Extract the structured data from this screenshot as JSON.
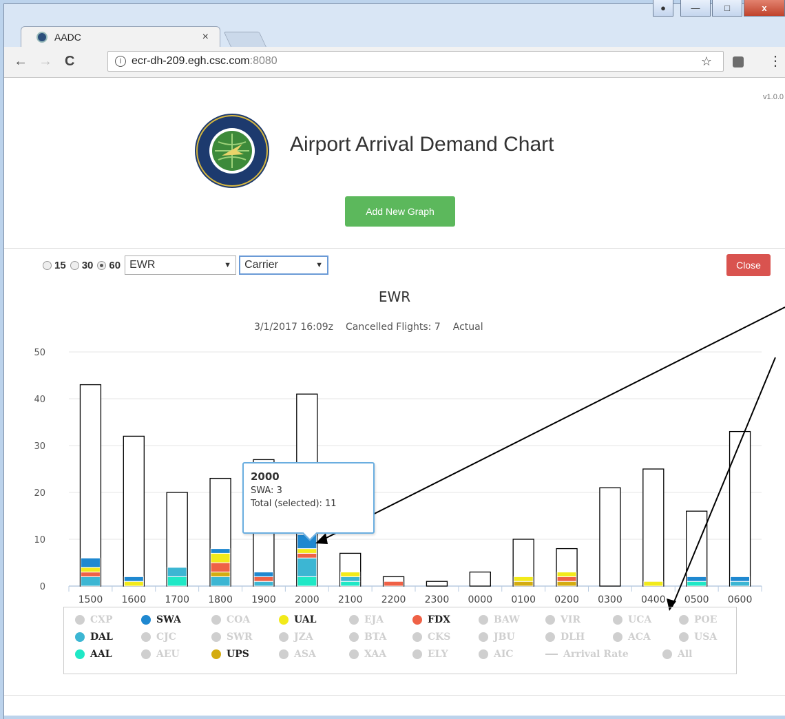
{
  "window": {
    "controls": [
      "user",
      "minimize",
      "maximize",
      "close"
    ],
    "close_glyph": "x"
  },
  "browser": {
    "tab_title": "AADC",
    "tab_close": "×",
    "url_host": "ecr-dh-209.egh.csc.com",
    "url_port": ":8080",
    "info_glyph": "i",
    "star_glyph": "☆",
    "menu_glyph": "⋮",
    "back_glyph": "←",
    "forward_glyph": "→",
    "reload_glyph": "C"
  },
  "page": {
    "version": "v1.0.0",
    "title": "Airport Arrival Demand Chart",
    "add_button": "Add New Graph"
  },
  "controls": {
    "intervals": [
      {
        "label": "15",
        "selected": false
      },
      {
        "label": "30",
        "selected": false
      },
      {
        "label": "60",
        "selected": true
      }
    ],
    "airport_select": "EWR",
    "group_select": "Carrier",
    "close_button": "Close"
  },
  "tooltip": {
    "title": "2000",
    "line1": "SWA: 3",
    "line2": "Total (selected): 11"
  },
  "legend": [
    [
      "CXP",
      "off",
      "#cfcfcf"
    ],
    [
      "SWA",
      "on",
      "#1f88d0"
    ],
    [
      "COA",
      "off",
      "#cfcfcf"
    ],
    [
      "UAL",
      "on",
      "#f2ea1a"
    ],
    [
      "EJA",
      "off",
      "#cfcfcf"
    ],
    [
      "FDX",
      "on",
      "#ef6146"
    ],
    [
      "BAW",
      "off",
      "#cfcfcf"
    ],
    [
      "VIR",
      "off",
      "#cfcfcf"
    ],
    [
      "UCA",
      "off",
      "#cfcfcf"
    ],
    [
      "POE",
      "off",
      "#cfcfcf"
    ],
    [
      "DAL",
      "on",
      "#3cb6d3"
    ],
    [
      "CJC",
      "off",
      "#cfcfcf"
    ],
    [
      "SWR",
      "off",
      "#cfcfcf"
    ],
    [
      "JZA",
      "off",
      "#cfcfcf"
    ],
    [
      "BTA",
      "off",
      "#cfcfcf"
    ],
    [
      "CKS",
      "off",
      "#cfcfcf"
    ],
    [
      "JBU",
      "off",
      "#cfcfcf"
    ],
    [
      "DLH",
      "off",
      "#cfcfcf"
    ],
    [
      "ACA",
      "off",
      "#cfcfcf"
    ],
    [
      "USA",
      "off",
      "#cfcfcf"
    ],
    [
      "AAL",
      "on",
      "#1fe8c6"
    ],
    [
      "AEU",
      "off",
      "#cfcfcf"
    ],
    [
      "UPS",
      "on",
      "#d4ac10"
    ],
    [
      "ASA",
      "off",
      "#cfcfcf"
    ],
    [
      "XAA",
      "off",
      "#cfcfcf"
    ],
    [
      "ELY",
      "off",
      "#cfcfcf"
    ],
    [
      "AIC",
      "off",
      "#cfcfcf"
    ],
    [
      "Arrival Rate",
      "line",
      "#cfcfcf"
    ],
    [
      "All",
      "off",
      "#cfcfcf"
    ]
  ],
  "chart_data": {
    "type": "bar",
    "title": "EWR",
    "subtitle_parts": [
      "3/1/2017 16:09z",
      "Cancelled Flights: 7",
      "Actual"
    ],
    "ylim": [
      0,
      50
    ],
    "yticks": [
      0,
      10,
      20,
      30,
      40,
      50
    ],
    "categories": [
      "1500",
      "1600",
      "1700",
      "1800",
      "1900",
      "2000",
      "2100",
      "2200",
      "2300",
      "0000",
      "0100",
      "0200",
      "0300",
      "0400",
      "0500",
      "0600"
    ],
    "totals": [
      43,
      32,
      20,
      23,
      27,
      41,
      7,
      2,
      1,
      3,
      10,
      8,
      21,
      25,
      16,
      33
    ],
    "series": [
      {
        "name": "AAL",
        "color": "#1fe8c6",
        "values": [
          0,
          0,
          2,
          0,
          0,
          2,
          1,
          0,
          0,
          0,
          0,
          0,
          0,
          0,
          1,
          0
        ]
      },
      {
        "name": "DAL",
        "color": "#3cb6d3",
        "values": [
          2,
          0,
          2,
          2,
          1,
          4,
          1,
          0,
          0,
          0,
          0,
          0,
          0,
          0,
          0,
          1
        ]
      },
      {
        "name": "UPS",
        "color": "#d4ac10",
        "values": [
          0,
          0,
          0,
          1,
          0,
          0,
          0,
          0,
          0,
          0,
          1,
          1,
          0,
          0,
          0,
          0
        ]
      },
      {
        "name": "FDX",
        "color": "#ef6146",
        "values": [
          1,
          0,
          0,
          2,
          1,
          1,
          0,
          1,
          0,
          0,
          0,
          1,
          0,
          0,
          0,
          0
        ]
      },
      {
        "name": "UAL",
        "color": "#f2ea1a",
        "values": [
          1,
          1,
          0,
          2,
          0,
          1,
          1,
          0,
          0,
          0,
          1,
          1,
          0,
          1,
          0,
          0
        ]
      },
      {
        "name": "SWA",
        "color": "#1f88d0",
        "values": [
          2,
          1,
          0,
          1,
          1,
          3,
          0,
          0,
          0,
          0,
          0,
          0,
          0,
          0,
          1,
          1
        ]
      }
    ]
  }
}
